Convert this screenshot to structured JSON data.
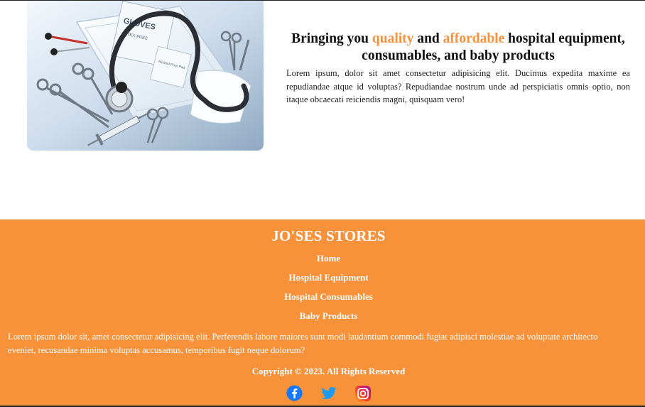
{
  "hero": {
    "heading_parts": [
      "Bringing you ",
      "quality",
      " and ",
      "affordable",
      " hospital equipment, consumables, and baby products"
    ],
    "body": "Lorem ipsum, dolor sit amet consectetur adipisicing elit. Ducimus expedita maxime ea repudiandae atque id voluptas? Repudiandae nostrum unde ad perspiciatis omnis optio, non itaque obcaecati reiciendis magni, quisquam vero!",
    "image": {
      "subject": "medical-supplies-photo",
      "glove_box_label": "GLOVES",
      "glove_box_sublabel": "LATEX-FREE",
      "pad_label": "Alcohol Prep Pad"
    },
    "accent_color": "#f7913a"
  },
  "footer": {
    "brand": "JO'SES STORES",
    "nav": [
      {
        "label": "Home"
      },
      {
        "label": "Hospital Equipment"
      },
      {
        "label": "Hospital Consumables"
      },
      {
        "label": "Baby Products"
      }
    ],
    "description_lines": [
      "Lorem ipsum dolor sit, amet consectetur adipisicing elit. Perferendis labore maiores sunt modi laudantium commodi fugiat adipisci molestiae ad voluptate architecto",
      "eveniet, recusandae minima voluptas accusamus, temporibus fugit neque dolorum?"
    ],
    "copyright": "Copyright © 2023. All Rights Reserved",
    "background_color": "#f7913a",
    "social": [
      "facebook-icon",
      "twitter-icon",
      "instagram-icon"
    ]
  }
}
